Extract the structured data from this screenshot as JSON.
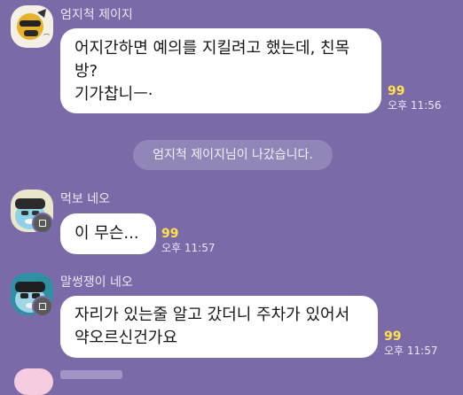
{
  "messages": [
    {
      "sender": "엄지척 제이지",
      "lines": [
        "어지간하면  예의를  지킬려고 했는데, 친목",
        "방?",
        "기가찹니ㅡ·"
      ],
      "unread": "99",
      "time": "오후 11:56"
    },
    {
      "sender": "먹보 네오",
      "lines": [
        "이 무슨..."
      ],
      "unread": "99",
      "time": "오후 11:57"
    },
    {
      "sender": "말썽쟁이 네오",
      "lines": [
        "자리가 있는줄 알고 갔더니 주차가 있어서",
        "약오르신건가요"
      ],
      "unread": "99",
      "time": "오후 11:57"
    }
  ],
  "system_notice": "엄지척 제이지님이 나갔습니다.",
  "colors": {
    "background": "#7a6ba8",
    "bubble": "#ffffff",
    "unread": "#ffe14a",
    "meta_text": "#ebe6f7"
  },
  "icons": {
    "avatar_1": "muzi-character-avatar",
    "avatar_2": "neo-character-avatar",
    "avatar_3": "neo-character-avatar",
    "badge": "open-chat-profile-badge-icon"
  }
}
